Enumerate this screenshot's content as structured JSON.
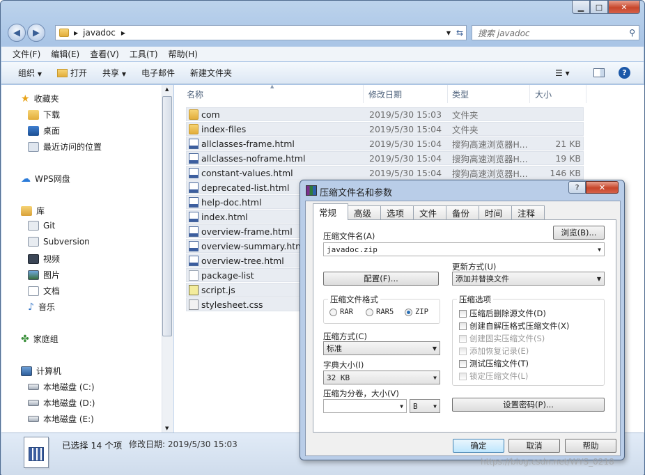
{
  "window": {
    "min": "▁",
    "max": "□",
    "close": "✕"
  },
  "address": {
    "path": "javadoc",
    "search_placeholder": "搜索 javadoc"
  },
  "menu": [
    "文件(F)",
    "编辑(E)",
    "查看(V)",
    "工具(T)",
    "帮助(H)"
  ],
  "toolbar": {
    "organize": "组织",
    "open": "打开",
    "share": "共享",
    "email": "电子邮件",
    "new_folder": "新建文件夹"
  },
  "sidebar": {
    "favorites": "收藏夹",
    "download": "下载",
    "desktop": "桌面",
    "recent": "最近访问的位置",
    "wps": "WPS网盘",
    "library": "库",
    "git": "Git",
    "subversion": "Subversion",
    "video": "视频",
    "pictures": "图片",
    "docs": "文档",
    "music": "音乐",
    "homegroup": "家庭组",
    "computer": "计算机",
    "disk_c": "本地磁盘 (C:)",
    "disk_d": "本地磁盘 (D:)",
    "disk_e": "本地磁盘 (E:)"
  },
  "columns": {
    "name": "名称",
    "date": "修改日期",
    "type": "类型",
    "size": "大小"
  },
  "files": [
    {
      "name": "com",
      "date": "2019/5/30 15:03",
      "type": "文件夹",
      "size": "",
      "icon": "folder"
    },
    {
      "name": "index-files",
      "date": "2019/5/30 15:04",
      "type": "文件夹",
      "size": "",
      "icon": "folder"
    },
    {
      "name": "allclasses-frame.html",
      "date": "2019/5/30 15:04",
      "type": "搜狗高速浏览器H...",
      "size": "21 KB",
      "icon": "html"
    },
    {
      "name": "allclasses-noframe.html",
      "date": "2019/5/30 15:04",
      "type": "搜狗高速浏览器H...",
      "size": "19 KB",
      "icon": "html"
    },
    {
      "name": "constant-values.html",
      "date": "2019/5/30 15:04",
      "type": "搜狗高速浏览器H...",
      "size": "146 KB",
      "icon": "html"
    },
    {
      "name": "deprecated-list.html",
      "date": "",
      "type": "",
      "size": "",
      "icon": "html"
    },
    {
      "name": "help-doc.html",
      "date": "",
      "type": "",
      "size": "",
      "icon": "html"
    },
    {
      "name": "index.html",
      "date": "",
      "type": "",
      "size": "",
      "icon": "html"
    },
    {
      "name": "overview-frame.html",
      "date": "",
      "type": "",
      "size": "",
      "icon": "html"
    },
    {
      "name": "overview-summary.html",
      "date": "",
      "type": "",
      "size": "",
      "icon": "html"
    },
    {
      "name": "overview-tree.html",
      "date": "",
      "type": "",
      "size": "",
      "icon": "html"
    },
    {
      "name": "package-list",
      "date": "",
      "type": "",
      "size": "",
      "icon": "txt"
    },
    {
      "name": "script.js",
      "date": "",
      "type": "",
      "size": "",
      "icon": "js"
    },
    {
      "name": "stylesheet.css",
      "date": "",
      "type": "",
      "size": "",
      "icon": "css"
    }
  ],
  "status": {
    "selected": "已选择 14 个项",
    "modified": "修改日期: 2019/5/30 15:03"
  },
  "dialog": {
    "title": "压缩文件名和参数",
    "help": "?",
    "close": "✕",
    "tabs": [
      "常规",
      "高级",
      "选项",
      "文件",
      "备份",
      "时间",
      "注释"
    ],
    "filename_label": "压缩文件名(A)",
    "browse": "浏览(B)...",
    "filename": "javadoc.zip",
    "update_label": "更新方式(U)",
    "update_value": "添加并替换文件",
    "profile": "配置(F)...",
    "format_label": "压缩文件格式",
    "formats": [
      "RAR",
      "RAR5",
      "ZIP"
    ],
    "options_label": "压缩选项",
    "options": [
      "压缩后删除源文件(D)",
      "创建自解压格式压缩文件(X)",
      "创建固实压缩文件(S)",
      "添加恢复记录(E)",
      "测试压缩文件(T)",
      "锁定压缩文件(L)"
    ],
    "method_label": "压缩方式(C)",
    "method_value": "标准",
    "dict_label": "字典大小(I)",
    "dict_value": "32 KB",
    "split_label": "压缩为分卷，大小(V)",
    "split_unit": "B",
    "password": "设置密码(P)...",
    "ok": "确定",
    "cancel": "取消",
    "help_btn": "帮助"
  },
  "watermark": "https://blog.csdn.net/WYS_0218"
}
